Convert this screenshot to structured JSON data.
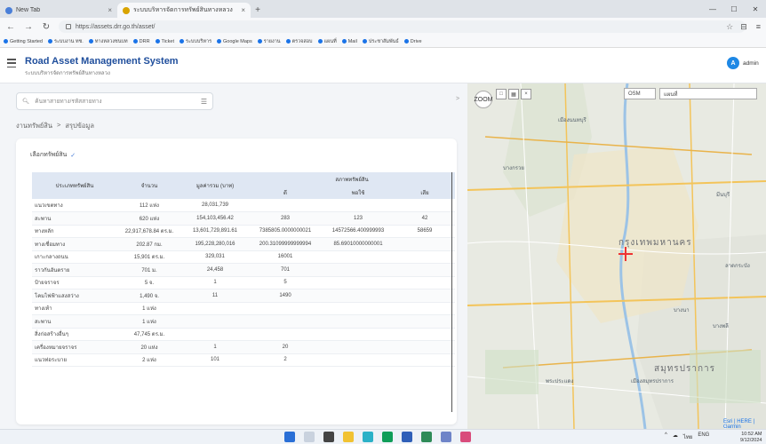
{
  "browser": {
    "tabs": [
      {
        "title": "New Tab",
        "active": false
      },
      {
        "title": "ระบบบริหารจัดการทรัพย์สินทางหลวง",
        "active": true
      }
    ],
    "new_tab": "+",
    "url": "https://assets.drr.go.th/asset/",
    "bookmarks": [
      "Getting Started",
      "ระบบงาน ทช.",
      "ทางหลวงชนบท",
      "DRR",
      "Ticket",
      "ระบบบริหาร",
      "Google Maps",
      "รายงาน",
      "ตรวจสอบ",
      "แผนที่",
      "Mail",
      "ประชาสัมพันธ์",
      "Drive"
    ]
  },
  "app": {
    "title": "Road Asset Management System",
    "subtitle": "ระบบบริหารจัดการทรัพย์สินทางหลวง",
    "user_initial": "A",
    "user_name": "admin"
  },
  "left": {
    "search_placeholder": "ค้นหาสายทาง/รหัสสายทาง",
    "breadcrumb": [
      "งานทรัพย์สิน",
      ">",
      "สรุปข้อมูล"
    ],
    "collapse": ">",
    "select_label": "เลือกทรัพย์สิน",
    "select_chev": "✓"
  },
  "table": {
    "headers": {
      "type": "ประเภททรัพย์สิน",
      "amount": "จำนวน",
      "value": "มูลค่ารวม (บาท)",
      "condition": "สภาพทรัพย์สิน",
      "good": "ดี",
      "fair": "พอใช้",
      "poor": "เสีย"
    },
    "rows": [
      [
        "แนวเขตทาง",
        "112 แห่ง",
        "28,031,739",
        "",
        "",
        ""
      ],
      [
        "สะพาน",
        "620 แห่ง",
        "154,103,456.42",
        "283",
        "123",
        "42"
      ],
      [
        "ทางหลัก",
        "22,917,678.84 ตร.ม.",
        "13,601,729,891.61",
        "7385805.0000000021",
        "14572566.400999993",
        "58659"
      ],
      [
        "ทางเชื่อมทาง",
        "202.87 กม.",
        "195,228,280,016",
        "200.31099999999994",
        "85.69010000000001",
        ""
      ],
      [
        "เกาะกลางถนน",
        "15,901 ตร.ม.",
        "329,031",
        "16001",
        "",
        ""
      ],
      [
        "ราวกันอันตราย",
        "701 ม.",
        "24,458",
        "701",
        "",
        ""
      ],
      [
        "ป้ายจราจร",
        "5 จ.",
        "1",
        "5",
        "",
        ""
      ],
      [
        "โคมไฟฟ้าแสงสว่าง",
        "1,490 จ.",
        "11",
        "1490",
        "",
        ""
      ],
      [
        "ทางเท้า",
        "1 แห่ง",
        "",
        "",
        "",
        ""
      ],
      [
        "สะพาน",
        "1 แห่ง",
        "",
        "",
        "",
        ""
      ],
      [
        "สิ่งก่อสร้างอื่นๆ",
        "47,745 ตร.ม.",
        "",
        "",
        "",
        ""
      ],
      [
        "เครื่องหมายจราจร",
        "20 แห่ง",
        "1",
        "20",
        "",
        ""
      ],
      [
        "แนวท่อระบาย",
        "2 แห่ง",
        "101",
        "2",
        "",
        ""
      ]
    ]
  },
  "map": {
    "zoom_label": "ZOOM",
    "tools": [
      "□",
      "▦",
      "×"
    ],
    "layer_select": "OSM",
    "basemap_select": "แผนที่",
    "labels": [
      "เมืองนนทบุรี",
      "กรุงเทพมหานคร",
      "สมุทรปราการ",
      "เมืองสมุทรปราการ",
      "พระประแดง",
      "บางกรวย",
      "บางพลี",
      "บางนา",
      "ลาดกระบัง",
      "มีนบุรี"
    ],
    "copyright": "Esri | HERE | Garmin"
  },
  "taskbar": {
    "tray": [
      "^",
      "☁",
      "ไทย",
      "ENG"
    ],
    "time": "10:52 AM",
    "date": "9/12/2024"
  },
  "colors": {
    "brand": "#1f4e9c",
    "header_bg": "#dfe7f3",
    "accent": "#1e88e5"
  }
}
